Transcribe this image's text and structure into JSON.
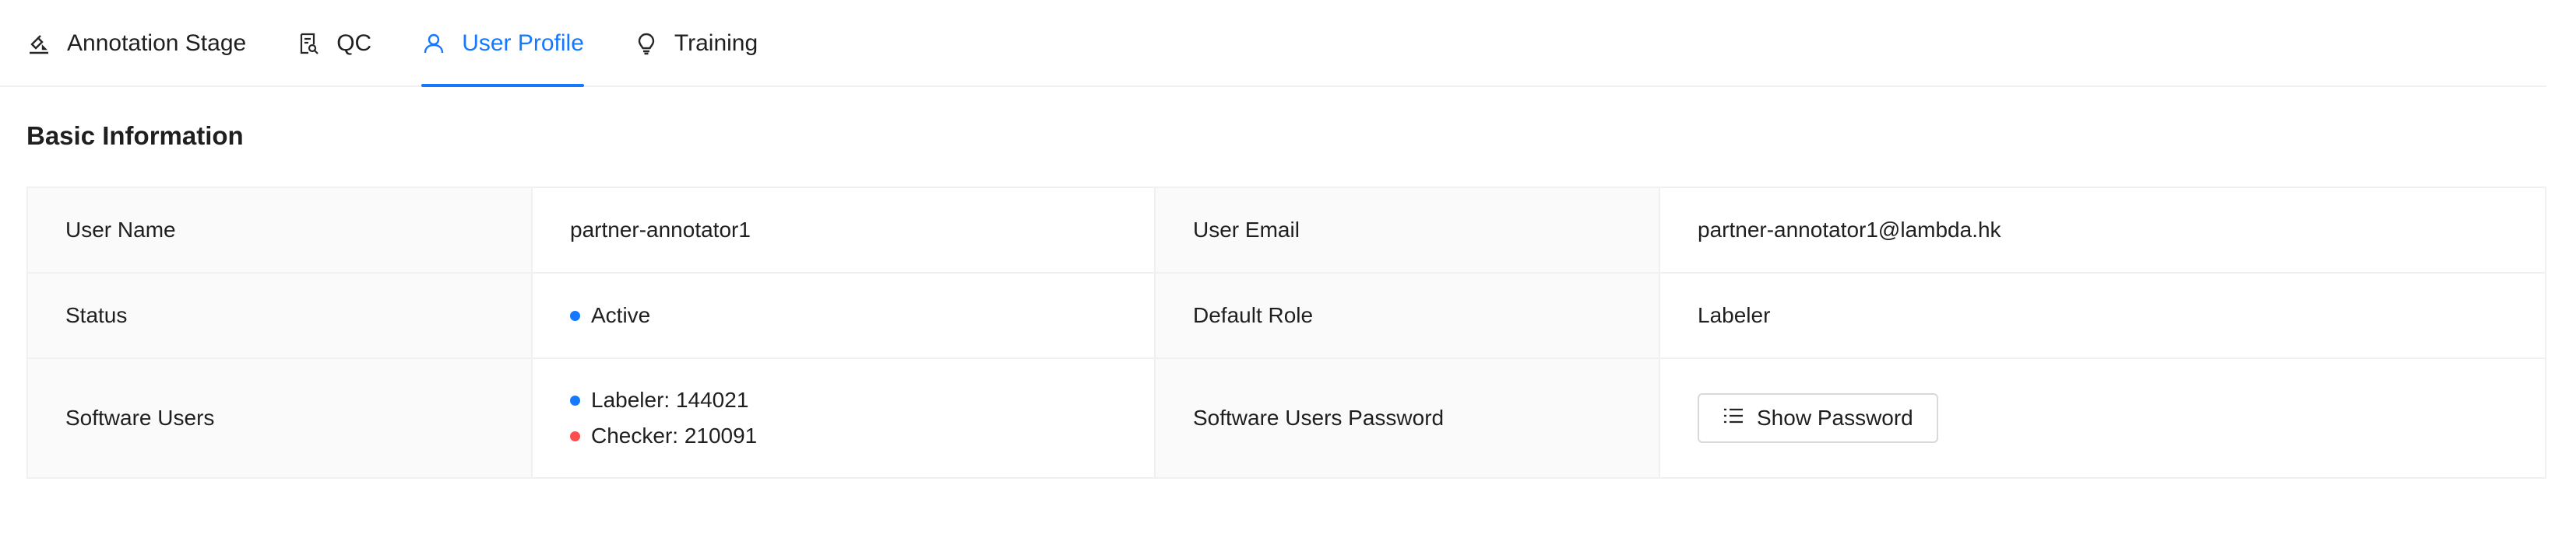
{
  "tabs": [
    {
      "label": "Annotation Stage",
      "icon": "annotation-stage-icon"
    },
    {
      "label": "QC",
      "icon": "qc-icon"
    },
    {
      "label": "User Profile",
      "icon": "user-icon",
      "active": true
    },
    {
      "label": "Training",
      "icon": "lightbulb-icon"
    }
  ],
  "section": {
    "title": "Basic Information"
  },
  "info": {
    "user_name_label": "User Name",
    "user_name": "partner-annotator1",
    "user_email_label": "User Email",
    "user_email": "partner-annotator1@lambda.hk",
    "status_label": "Status",
    "status": "Active",
    "default_role_label": "Default Role",
    "default_role": "Labeler",
    "software_users_label": "Software Users",
    "software_users": [
      "Labeler: 144021",
      "Checker: 210091"
    ],
    "software_password_label": "Software Users Password",
    "show_password_label": "Show Password"
  },
  "colors": {
    "accent": "#1677ff",
    "danger": "#ff4d4f"
  }
}
